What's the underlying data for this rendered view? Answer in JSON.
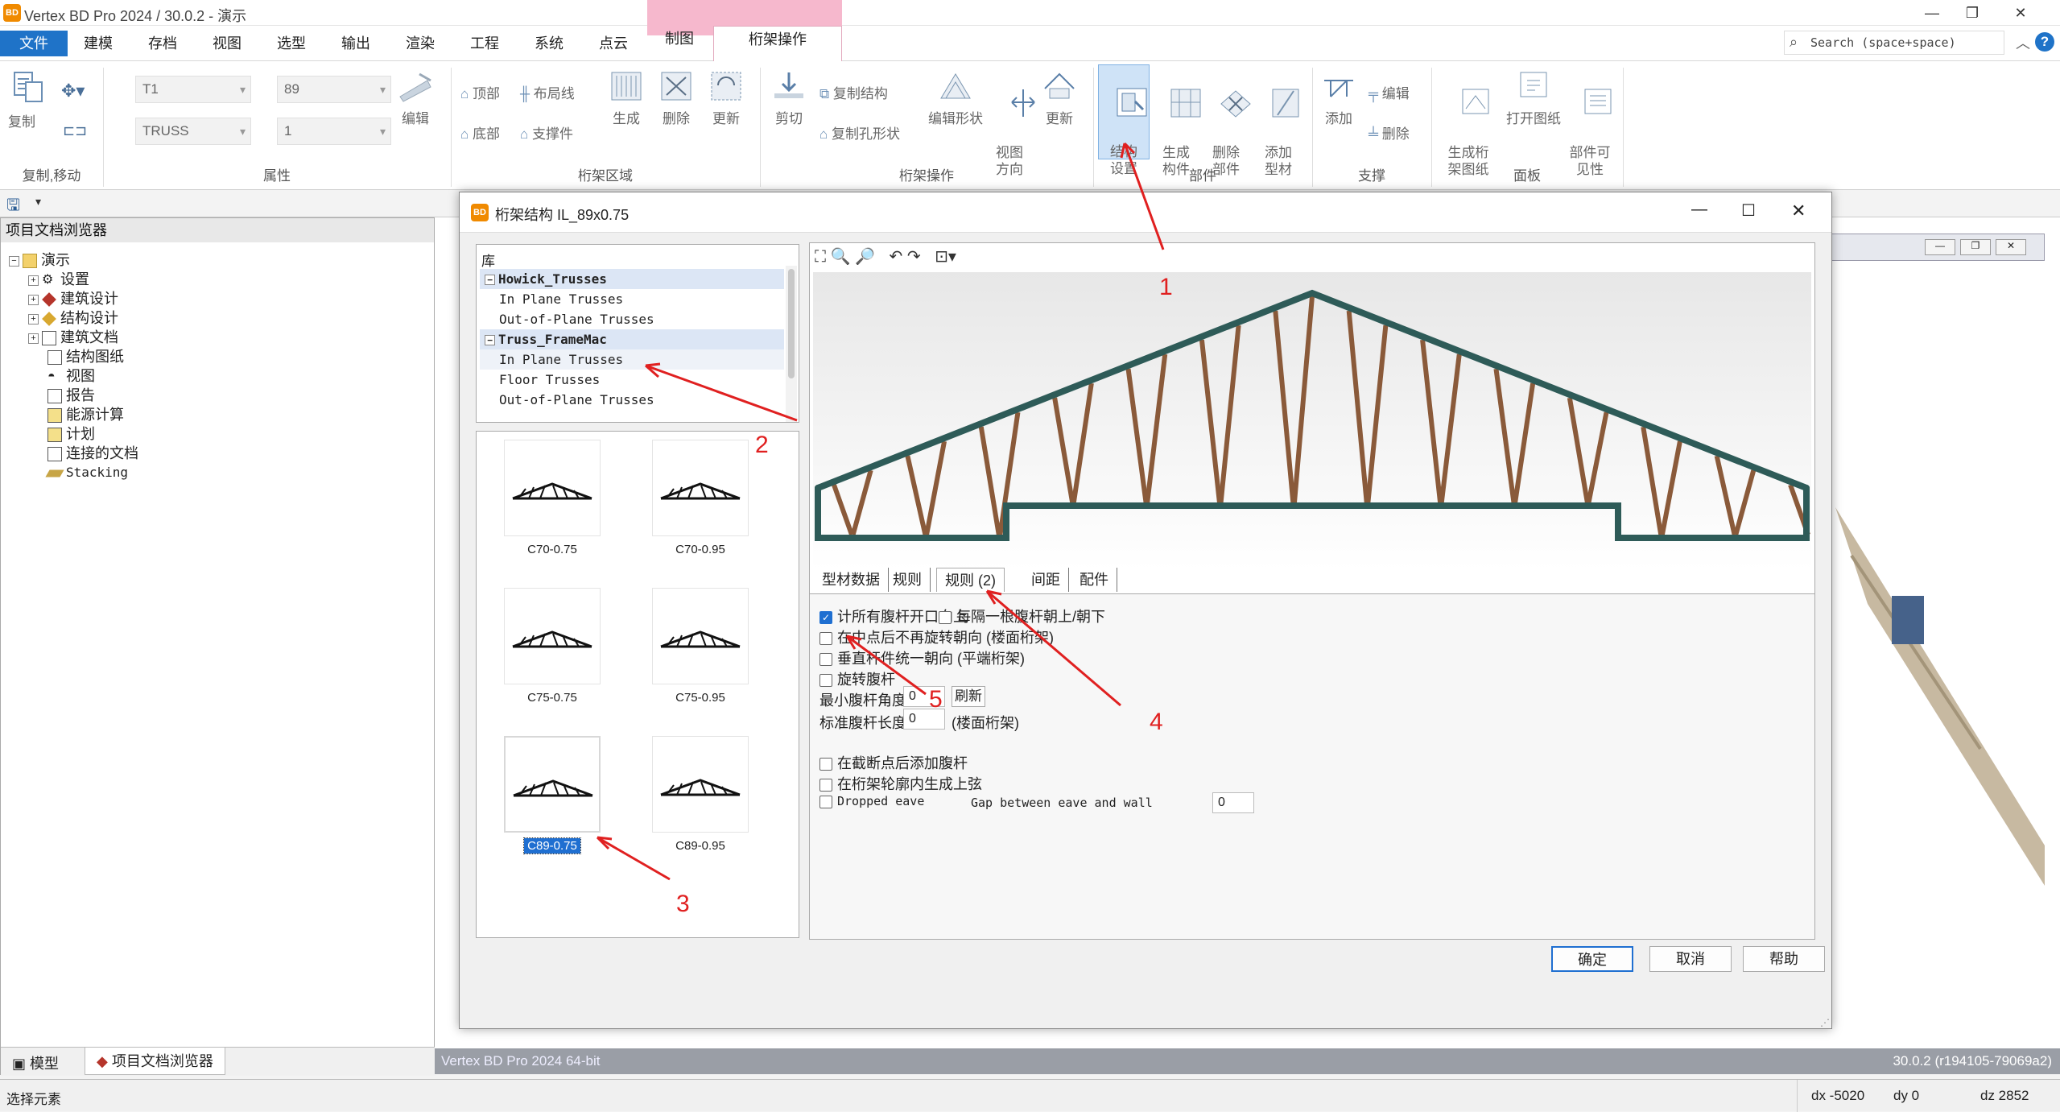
{
  "app": {
    "title": "Vertex BD Pro 2024 / 30.0.2 - 演示",
    "search_placeholder": "Search (space+space)"
  },
  "menu": {
    "items": [
      "文件",
      "建模",
      "存档",
      "视图",
      "选型",
      "输出",
      "渲染",
      "工程",
      "系统",
      "点云"
    ],
    "context_tabs": [
      "制图",
      "桁架操作"
    ]
  },
  "ribbon": {
    "copy_move": {
      "copy": "复制",
      "group": "复制,移动"
    },
    "props": {
      "combo1": "T1",
      "combo2": "89",
      "combo3": "TRUSS",
      "combo4": "1",
      "edit": "编辑",
      "group": "属性"
    },
    "area": {
      "top": "顶部",
      "layout": "布局线",
      "bottom": "底部",
      "support": "支撑件",
      "generate": "生成",
      "delete": "删除",
      "update": "更新",
      "group": "桁架区域"
    },
    "ops": {
      "cut": "剪切",
      "copy_struct": "复制结构",
      "copy_hole": "复制孔形状",
      "edit_shape": "编辑形状",
      "view_dir": "视图\n方向",
      "update": "更新",
      "group": "桁架操作"
    },
    "parts": {
      "struct_settings": "结构\n设置",
      "gen_parts": "生成\n构件",
      "del_parts": "删除\n部件",
      "add_profile": "添加\n型材",
      "group": "部件"
    },
    "brace": {
      "add": "添加",
      "edit": "编辑",
      "delete": "删除",
      "group": "支撑"
    },
    "panel": {
      "gen_sheet": "生成桁\n架图纸",
      "open_sheet": "打开图纸",
      "visibility": "部件可\n见性",
      "group": "面板"
    }
  },
  "browser": {
    "title": "项目文档浏览器",
    "tree": [
      "演示",
      "设置",
      "建筑设计",
      "结构设计",
      "建筑文档",
      "结构图纸",
      "视图",
      "报告",
      "能源计算",
      "计划",
      "连接的文档",
      "Stacking"
    ],
    "bottom_tabs": [
      "模型",
      "项目文档浏览器"
    ]
  },
  "status": {
    "left": "选择元素",
    "dx": "dx -5020",
    "dy": "dy 0",
    "dz": "dz 2852",
    "version": "30.0.2 (r194105-79069a2)",
    "footer": "Vertex BD Pro 2024 64-bit"
  },
  "dialog": {
    "title": "桁架结构 IL_89x0.75",
    "library_header": "库",
    "library": [
      {
        "text": "Howick_Trusses",
        "level": 0,
        "bold": true
      },
      {
        "text": "In Plane Trusses",
        "level": 1
      },
      {
        "text": "Out-of-Plane Trusses",
        "level": 1
      },
      {
        "text": "Truss_FrameMac",
        "level": 0,
        "bold": true
      },
      {
        "text": "In Plane Trusses",
        "level": 1
      },
      {
        "text": "Floor Trusses",
        "level": 1
      },
      {
        "text": "Out-of-Plane Trusses",
        "level": 1
      }
    ],
    "thumbs": [
      "C70-0.75",
      "C70-0.95",
      "C75-0.75",
      "C75-0.95",
      "C89-0.75",
      "C89-0.95"
    ],
    "tabs": [
      "型材数据",
      "规则",
      "规则 (2)",
      "间距",
      "配件"
    ],
    "options": {
      "opt1": "计所有腹杆开口向上",
      "opt1b": "每隔一根腹杆朝上/朝下",
      "opt2": "在中点后不再旋转朝向 (楼面桁架)",
      "opt3": "垂直杆件统一朝向 (平端桁架)",
      "opt4": "旋转腹杆",
      "min_angle_label": "最小腹杆角度",
      "min_angle_value": "0",
      "refresh": "刷新",
      "std_len_label": "标准腹杆长度",
      "std_len_value": "0",
      "std_len_note": "(楼面桁架)",
      "opt5": "在截断点后添加腹杆",
      "opt6": "在桁架轮廓内生成上弦",
      "opt7": "Dropped eave",
      "gap_label": "Gap between eave and wall",
      "gap_value": "0"
    },
    "buttons": {
      "ok": "确定",
      "cancel": "取消",
      "help": "帮助"
    }
  },
  "annotations": [
    "1",
    "2",
    "3",
    "4",
    "5"
  ],
  "colors": {
    "accent": "#1f73c8",
    "context": "#f6b8cd",
    "truss_chord": "#2e5b58",
    "truss_web": "#8a5a3a",
    "annotation": "#e02020"
  }
}
